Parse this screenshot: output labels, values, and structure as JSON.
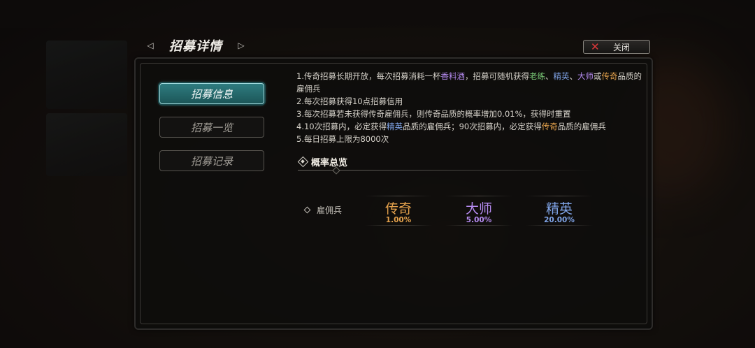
{
  "header": {
    "title": "招募详情",
    "close_label": "关闭"
  },
  "tabs": [
    {
      "label": "招募信息",
      "active": true
    },
    {
      "label": "招募一览",
      "active": false
    },
    {
      "label": "招募记录",
      "active": false
    }
  ],
  "rules": {
    "line1": {
      "a": "1.传奇招募长期开放，每次招募消耗一杯",
      "item": "香料酒",
      "b": "，招募可随机获得",
      "q1": "老练",
      "sep1": "、",
      "q2": "精英",
      "sep2": "、",
      "q3": "大师",
      "or": "或",
      "q4": "传奇",
      "c": "品质的",
      "d": "雇佣兵"
    },
    "line2": "2.每次招募获得10点招募信用",
    "line3": "3.每次招募若未获得传奇雇佣兵，则传奇品质的概率增加0.01%，获得时重置",
    "line4": {
      "a": "4.10次招募内，必定获得",
      "q1": "精英",
      "b": "品质的雇佣兵；90次招募内，必定获得",
      "q2": "传奇",
      "c": "品质的雇佣兵"
    },
    "line5": "5.每日招募上限为8000次"
  },
  "overview": {
    "title": "概率总览",
    "row_label": "雇佣兵",
    "qualities": [
      {
        "name": "传奇",
        "percent": "1.00%",
        "color": "#e3a14c"
      },
      {
        "name": "大师",
        "percent": "5.00%",
        "color": "#b58bf0"
      },
      {
        "name": "精英",
        "percent": "20.00%",
        "color": "#7fa3e6"
      }
    ]
  },
  "colors": {
    "accent_tab": "#2f7c80",
    "close_x": "#e0393b",
    "veteran": "#7ed07a",
    "elite": "#7fa3e6",
    "master": "#b58bf0",
    "legend": "#e3a14c"
  }
}
